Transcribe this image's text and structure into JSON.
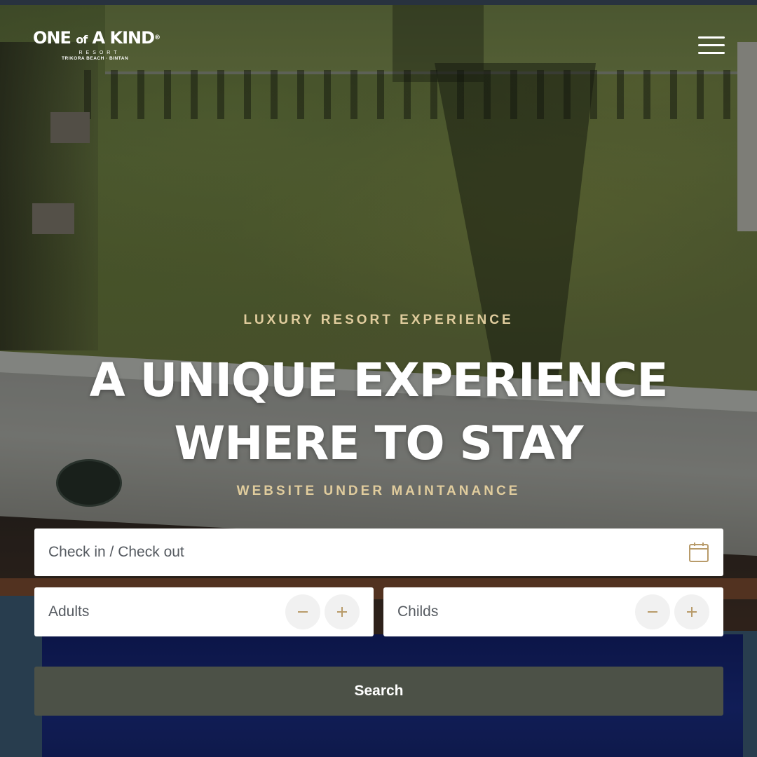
{
  "brand": {
    "logo_main": "ONE of A KIND",
    "logo_main_pre": "ONE ",
    "logo_of": "of",
    "logo_main_post": " A KIND",
    "logo_reg": "®",
    "logo_resort": "RESORT",
    "logo_location": "TRIKORA BEACH · BINTAN"
  },
  "header": {
    "menu_icon": "hamburger-icon"
  },
  "hero": {
    "eyebrow": "LUXURY RESORT EXPERIENCE",
    "headline_line1": "A UNIQUE EXPERIENCE",
    "headline_line2": "WHERE TO STAY",
    "maintenance": "WEBSITE UNDER MAINTANANCE"
  },
  "booking": {
    "date_placeholder": "Check in / Check out",
    "date_icon": "calendar-icon",
    "adults_label": "Adults",
    "childs_label": "Childs",
    "decrement_icon": "minus-icon",
    "increment_icon": "plus-icon",
    "search_label": "Search"
  },
  "colors": {
    "accent_gold": "#e0cc9d",
    "button_dark": "#4c5147",
    "stepper_icon": "#b89b6a"
  }
}
